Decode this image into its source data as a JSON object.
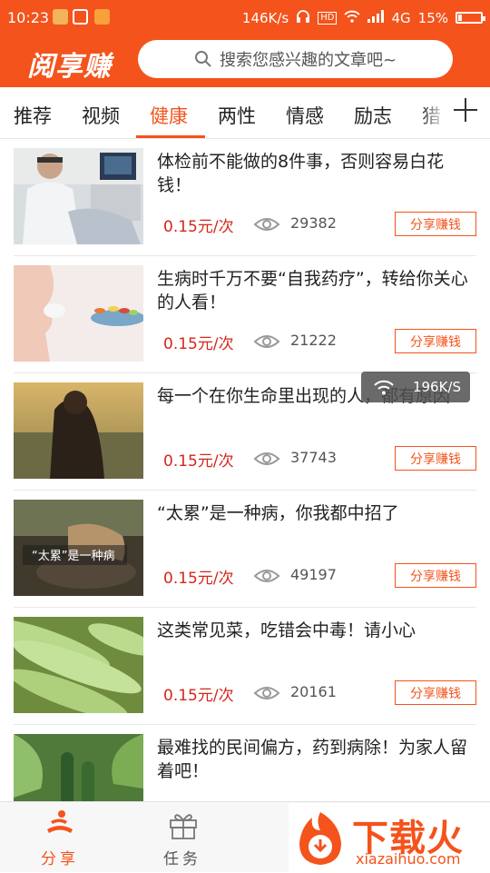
{
  "status_bar": {
    "time": "10:23",
    "speed": "146K/s",
    "network": "4G",
    "battery": "15%"
  },
  "header": {
    "logo": "阅享赚",
    "search_placeholder": "搜索您感兴趣的文章吧~"
  },
  "tabs": [
    "推荐",
    "视频",
    "健康",
    "两性",
    "情感",
    "励志",
    "猎"
  ],
  "active_tab": "健康",
  "articles": [
    {
      "title": "体检前不能做的8件事，否则容易白花钱！",
      "price": "0.15元/次",
      "views": "29382",
      "share": "分享赚钱"
    },
    {
      "title": "生病时千万不要“自我药疗”，转给你关心的人看！",
      "price": "0.15元/次",
      "views": "21222",
      "share": "分享赚钱"
    },
    {
      "title": "每一个在你生命里出现的人，都有原因",
      "price": "0.15元/次",
      "views": "37743",
      "share": "分享赚钱"
    },
    {
      "title": "“太累”是一种病，你我都中招了",
      "price": "0.15元/次",
      "views": "49197",
      "share": "分享赚钱",
      "thumb_caption": "“太累”是一种病"
    },
    {
      "title": "这类常见菜，吃错会中毒！请小心",
      "price": "0.15元/次",
      "views": "20161",
      "share": "分享赚钱"
    },
    {
      "title": "最难找的民间偏方，药到病除！为家人留着吧！",
      "price": "",
      "views": "",
      "share": ""
    }
  ],
  "floating_speed": "196K/S",
  "bottom_nav": [
    {
      "label": "分享",
      "active": true
    },
    {
      "label": "任务",
      "active": false
    }
  ],
  "watermark": {
    "text": "下载火",
    "sub": "xiazaihuo.com"
  },
  "colors": {
    "brand": "#f4531c",
    "price": "#d4261b"
  }
}
